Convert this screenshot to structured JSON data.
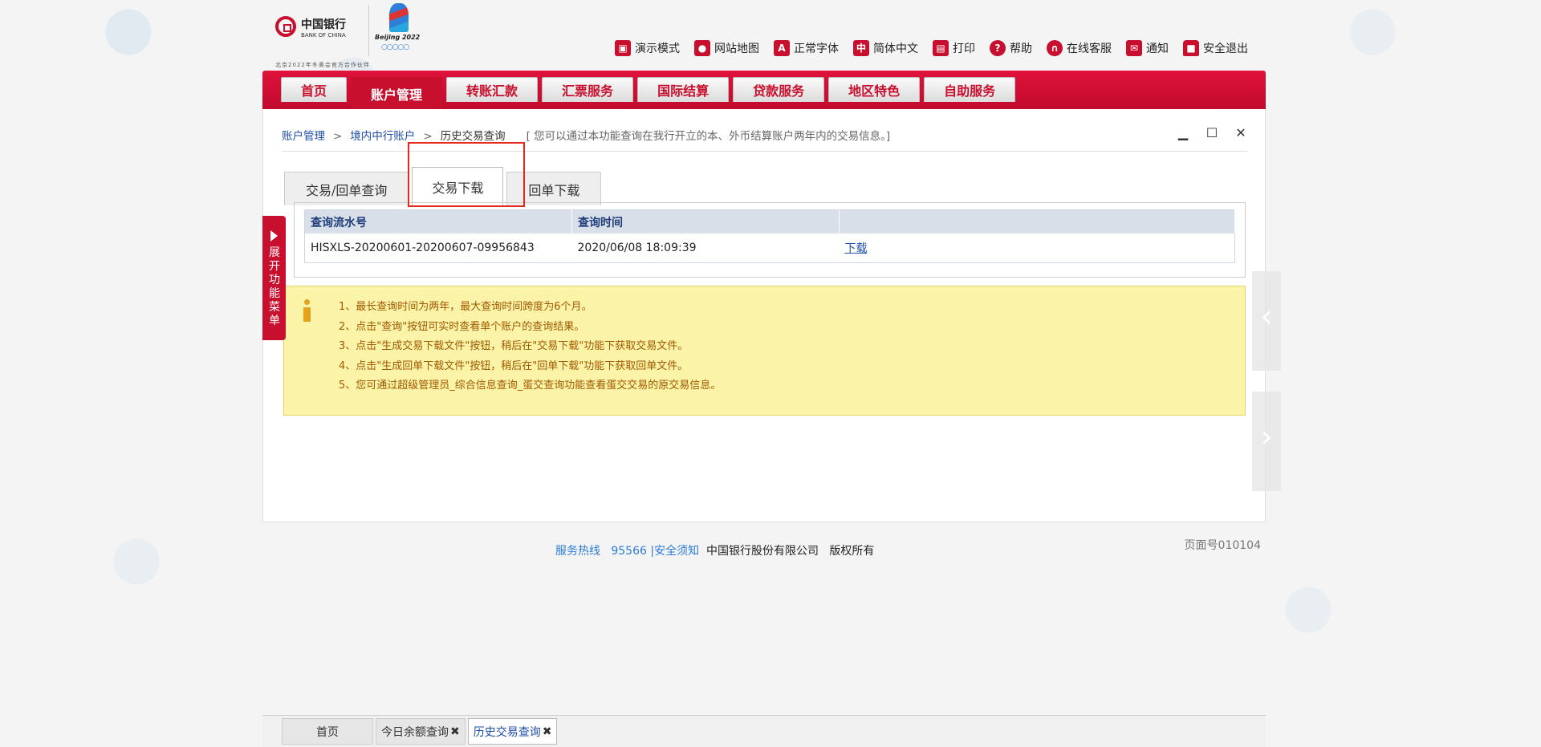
{
  "header": {
    "boc_cn": "中国银行",
    "boc_en": "BANK OF CHINA",
    "beijing": "Beijing 2022",
    "rings": "○○○○○",
    "tagline": "北京2022年冬奥会官方合作伙伴",
    "links": [
      {
        "label": "演示模式",
        "icon": "film-icon"
      },
      {
        "label": "网站地图",
        "icon": "map-pin-icon"
      },
      {
        "label": "正常字体",
        "icon": "font-icon"
      },
      {
        "label": "简体中文",
        "icon": "chinese-char-icon"
      },
      {
        "label": "打印",
        "icon": "printer-icon"
      },
      {
        "label": "帮助",
        "icon": "help-icon"
      },
      {
        "label": "在线客服",
        "icon": "headset-icon"
      },
      {
        "label": "通知",
        "icon": "mail-icon"
      },
      {
        "label": "安全退出",
        "icon": "lock-icon"
      }
    ]
  },
  "nav": {
    "tabs": [
      "首页",
      "账户管理",
      "转账汇款",
      "汇票服务",
      "国际结算",
      "贷款服务",
      "地区特色",
      "自助服务"
    ],
    "active": "账户管理"
  },
  "breadcrumb": {
    "items": [
      "账户管理",
      "境内中行账户",
      "历史交易查询"
    ],
    "note": "[ 您可以通过本功能查询在我行开立的本、外币结算账户两年内的交易信息。]"
  },
  "subtabs": {
    "items": [
      "交易/回单查询",
      "交易下载",
      "回单下载"
    ],
    "active": "交易下载"
  },
  "table": {
    "headers": [
      "查询流水号",
      "查询时间",
      ""
    ],
    "rows": [
      {
        "serial": "HISXLS-20200601-20200607-09956843",
        "time": "2020/06/08 18:09:39",
        "action": "下载"
      }
    ]
  },
  "notice": {
    "items": [
      "1、最长查询时间为两年，最大查询时间跨度为6个月。",
      "2、点击\"查询\"按钮可实时查看单个账户的查询结果。",
      "3、点击\"生成交易下载文件\"按钮，稍后在\"交易下载\"功能下获取交易文件。",
      "4、点击\"生成回单下载文件\"按钮，稍后在\"回单下载\"功能下获取回单文件。",
      "5、您可通过超级管理员_综合信息查询_蛋交查询功能查看蛋交交易的原交易信息。"
    ]
  },
  "side": {
    "expand_label": "展开功能菜单"
  },
  "footer": {
    "hotline_label": "服务热线",
    "hotline": "95566",
    "sep": "|",
    "security": "安全须知",
    "company": "中国银行股份有限公司",
    "rights": "版权所有",
    "page_id": "页面号010104"
  },
  "bottom_tabs": [
    {
      "label": "首页",
      "closable": false
    },
    {
      "label": "今日余额查询",
      "closable": true
    },
    {
      "label": "历史交易查询",
      "closable": true,
      "active": true
    }
  ],
  "colors": {
    "brand": "#c8102e",
    "notice_bg": "#fbf3a8",
    "highlight": "#e4281e"
  }
}
